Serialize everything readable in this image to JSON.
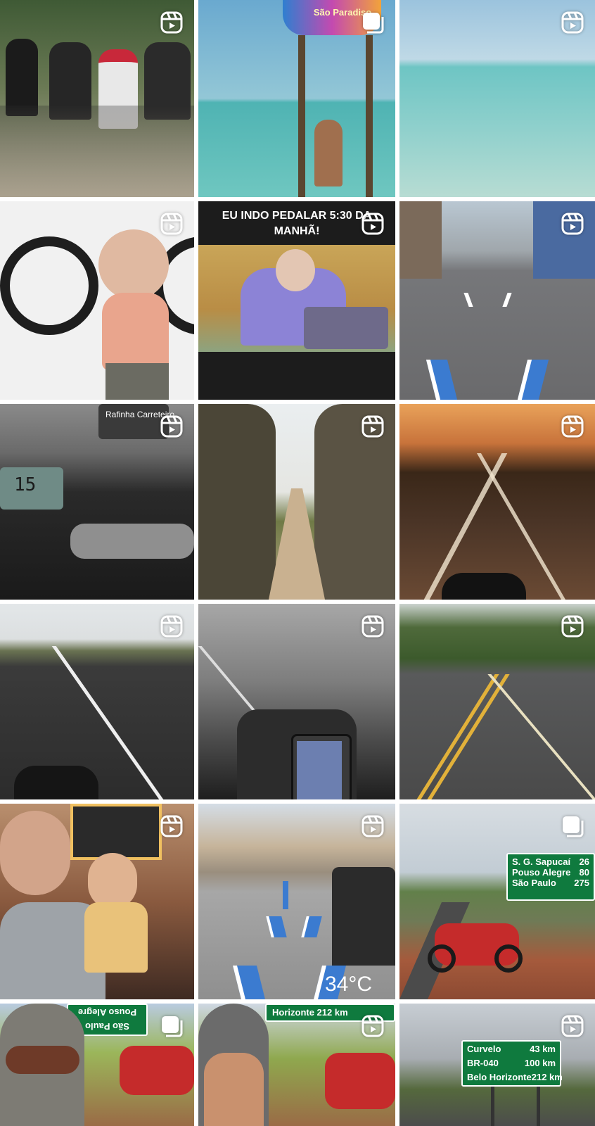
{
  "grid": {
    "tiles": [
      {
        "id": "t1",
        "badge": "reels-icon"
      },
      {
        "id": "t2",
        "badge": "carousel-icon",
        "overlay": "São Paradiso"
      },
      {
        "id": "t3",
        "badge": "reels-icon"
      },
      {
        "id": "t4",
        "badge": "reels-icon"
      },
      {
        "id": "t5",
        "badge": "reels-icon",
        "caption": "EU INDO PEDALAR 5:30 DA MANHÃ!"
      },
      {
        "id": "t6",
        "badge": "reels-icon"
      },
      {
        "id": "t7",
        "badge": "reels-icon",
        "truck_text": "Rafinha Carreteiro",
        "speed": "15"
      },
      {
        "id": "t8",
        "badge": "reels-icon"
      },
      {
        "id": "t9",
        "badge": "reels-icon"
      },
      {
        "id": "t10",
        "badge": "reels-icon"
      },
      {
        "id": "t11",
        "badge": "reels-icon"
      },
      {
        "id": "t12",
        "badge": "reels-icon"
      },
      {
        "id": "t13",
        "badge": "reels-icon"
      },
      {
        "id": "t14",
        "badge": "reels-icon",
        "temperature": "34°C"
      },
      {
        "id": "t15",
        "badge": "carousel-icon",
        "sign": [
          [
            "S. G. Sapucaí",
            "26"
          ],
          [
            "Pouso Alegre",
            "80"
          ],
          [
            "São Paulo",
            "275"
          ]
        ]
      },
      {
        "id": "t16",
        "badge": "carousel-icon",
        "sign": [
          "Pouso Alegre",
          "São Paulo"
        ]
      },
      {
        "id": "t17",
        "badge": "reels-icon",
        "sign": "Horizonte 212 km"
      },
      {
        "id": "t18",
        "badge": "reels-icon",
        "sign": [
          [
            "Curvelo",
            "43 km"
          ],
          [
            "BR-040",
            "100 km"
          ],
          [
            "Belo Horizonte",
            "212 km"
          ]
        ]
      }
    ]
  },
  "colors": {
    "background": "#ffffff",
    "sign_green": "#0f7a3e",
    "badge": "#ffffff"
  }
}
